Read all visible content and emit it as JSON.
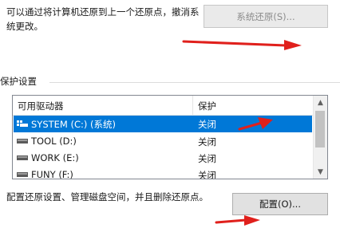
{
  "restore": {
    "description": "可以通过将计算机还原到上一个还原点，撤消系统更改。",
    "button_label": "系统还原(S)..."
  },
  "protection": {
    "group_title": "保护设置",
    "columns": {
      "drive": "可用驱动器",
      "protection": "保护"
    },
    "drives": [
      {
        "name": "SYSTEM (C:) (系统)",
        "status": "关闭",
        "selected": true,
        "icon": "system-drive-icon"
      },
      {
        "name": "TOOL (D:)",
        "status": "关闭",
        "selected": false,
        "icon": "drive-icon"
      },
      {
        "name": "WORK (E:)",
        "status": "关闭",
        "selected": false,
        "icon": "drive-icon"
      },
      {
        "name": "FUNY (F:)",
        "status": "关闭",
        "selected": false,
        "icon": "drive-icon"
      }
    ]
  },
  "configure": {
    "description": "配置还原设置、管理磁盘空间，并且删除还原点。",
    "button_label": "配置(O)..."
  },
  "colors": {
    "selection": "#0078d7",
    "annotation_arrow": "#e0201c"
  }
}
